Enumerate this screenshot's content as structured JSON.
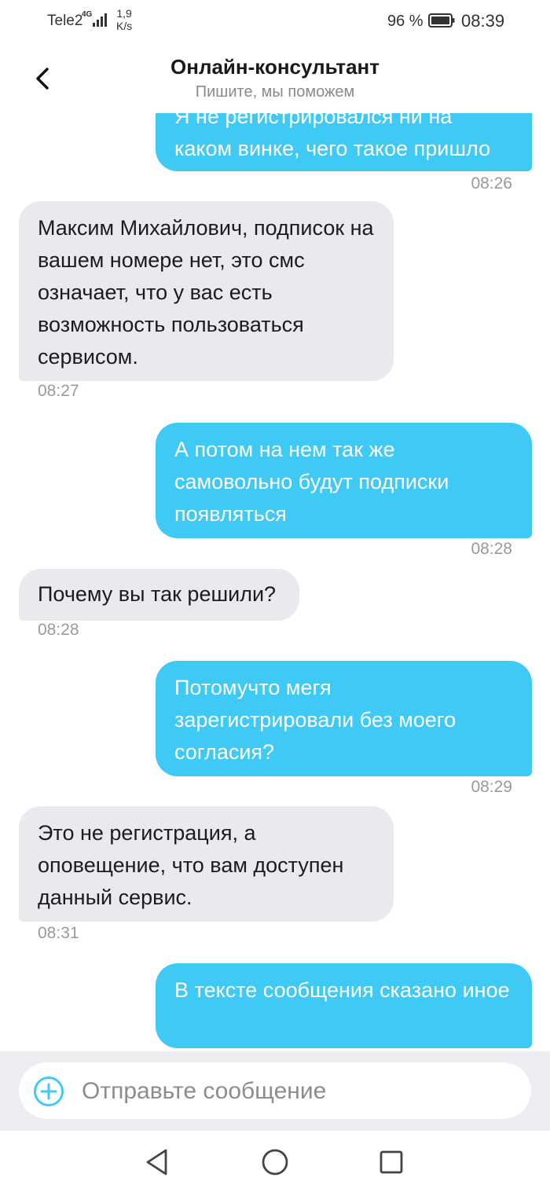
{
  "status_bar": {
    "carrier": "Tele2",
    "network": "4G",
    "speed_value": "1,9",
    "speed_unit": "K/s",
    "battery_pct": "96 %",
    "time": "08:39",
    "icons": [
      "signal-icon",
      "battery-icon"
    ]
  },
  "header": {
    "title": "Онлайн-консультант",
    "subtitle": "Пишите, мы поможем",
    "back_icon": "chevron-left-icon"
  },
  "messages": [
    {
      "from": "user",
      "text": "Я не регистрировался ни на каком винке, чего такое пришло",
      "time": "08:26"
    },
    {
      "from": "agent",
      "text": "Максим Михайлович, подписок на вашем номере нет, это смс означает, что у вас есть возможность пользоваться сервисом.",
      "time": "08:27"
    },
    {
      "from": "user",
      "text": "А потом на нем так же самовольно будут подписки появляться",
      "time": "08:28"
    },
    {
      "from": "agent",
      "text": "Почему вы так решили?",
      "time": "08:28"
    },
    {
      "from": "user",
      "text": "Потомучто мегя зарегистрировали без моего согласия?",
      "time": "08:29"
    },
    {
      "from": "agent",
      "text": "Это не регистрация, а оповещение, что вам доступен данный сервис.",
      "time": "08:31"
    },
    {
      "from": "user",
      "text": "В тексте сообщения сказано иное",
      "time": ""
    }
  ],
  "composer": {
    "placeholder": "Отправьте сообщение",
    "value": "",
    "attach_icon": "plus-circle-icon"
  },
  "nav_bar": {
    "icons": [
      "back-triangle-icon",
      "home-circle-icon",
      "recents-square-icon"
    ]
  },
  "colors": {
    "outgoing_bubble": "#3fc9f5",
    "incoming_bubble": "#e9e9ee",
    "accent": "#3fc9f5"
  }
}
